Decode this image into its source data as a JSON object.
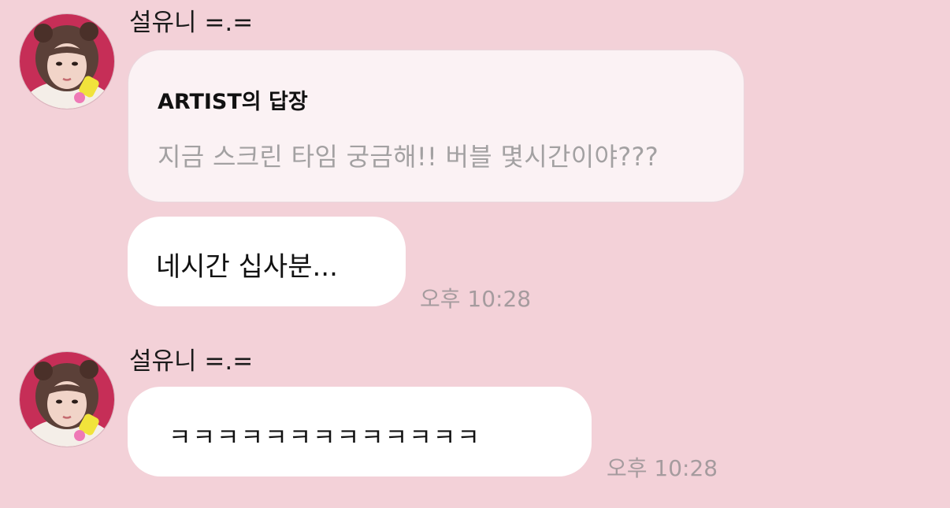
{
  "conversation": {
    "message_group_1": {
      "sender": "설유니 =.=",
      "reply": {
        "title": "ARTIST의 답장",
        "quote": "지금 스크린 타임 궁금해!! 버블 몇시간이야???"
      },
      "message": "네시간 십사분...",
      "time": "오후 10:28"
    },
    "message_group_2": {
      "sender": "설유니 =.=",
      "message": "ㅋㅋㅋㅋㅋㅋㅋㅋㅋㅋㅋㅋㅋ",
      "time": "오후 10:28"
    }
  },
  "colors": {
    "background": "#f3d1d8",
    "bubble": "#ffffff",
    "reply_bubble": "#fbf2f4",
    "timestamp": "#a59b9e"
  }
}
